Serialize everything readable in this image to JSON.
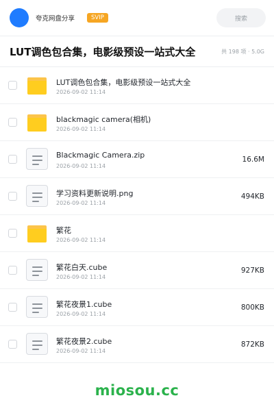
{
  "header": {
    "sharer_name": "夸克网盘分享",
    "badge": "SVIP",
    "search_label": "搜索"
  },
  "share": {
    "title": "LUT调色包合集，电影级预设一站式大全",
    "summary": "共 198 项 · 5.0G"
  },
  "files": [
    {
      "type": "folder",
      "name": "LUT调色包合集，电影级预设一站式大全",
      "time": "2026-09-02 11:14",
      "size": ""
    },
    {
      "type": "folder",
      "name": "blackmagic camera(相机)",
      "time": "2026-09-02 11:14",
      "size": ""
    },
    {
      "type": "file",
      "name": "Blackmagic Camera.zip",
      "time": "2026-09-02 11:14",
      "size": "16.6M"
    },
    {
      "type": "file",
      "name": "学习资料更新说明.png",
      "time": "2026-09-02 11:14",
      "size": "494KB"
    },
    {
      "type": "folder",
      "name": "繁花",
      "time": "2026-09-02 11:14",
      "size": ""
    },
    {
      "type": "file",
      "name": "繁花白天.cube",
      "time": "2026-09-02 11:14",
      "size": "927KB"
    },
    {
      "type": "file",
      "name": "繁花夜景1.cube",
      "time": "2026-09-02 11:14",
      "size": "800KB"
    },
    {
      "type": "file",
      "name": "繁花夜景2.cube",
      "time": "2026-09-02 11:14",
      "size": "872KB"
    }
  ],
  "watermark": "miosou.cc",
  "colors": {
    "avatar": "#1f7cff",
    "badge": "#f6a623",
    "folder": "#ffcd1f",
    "watermark": "#2bb24c"
  }
}
